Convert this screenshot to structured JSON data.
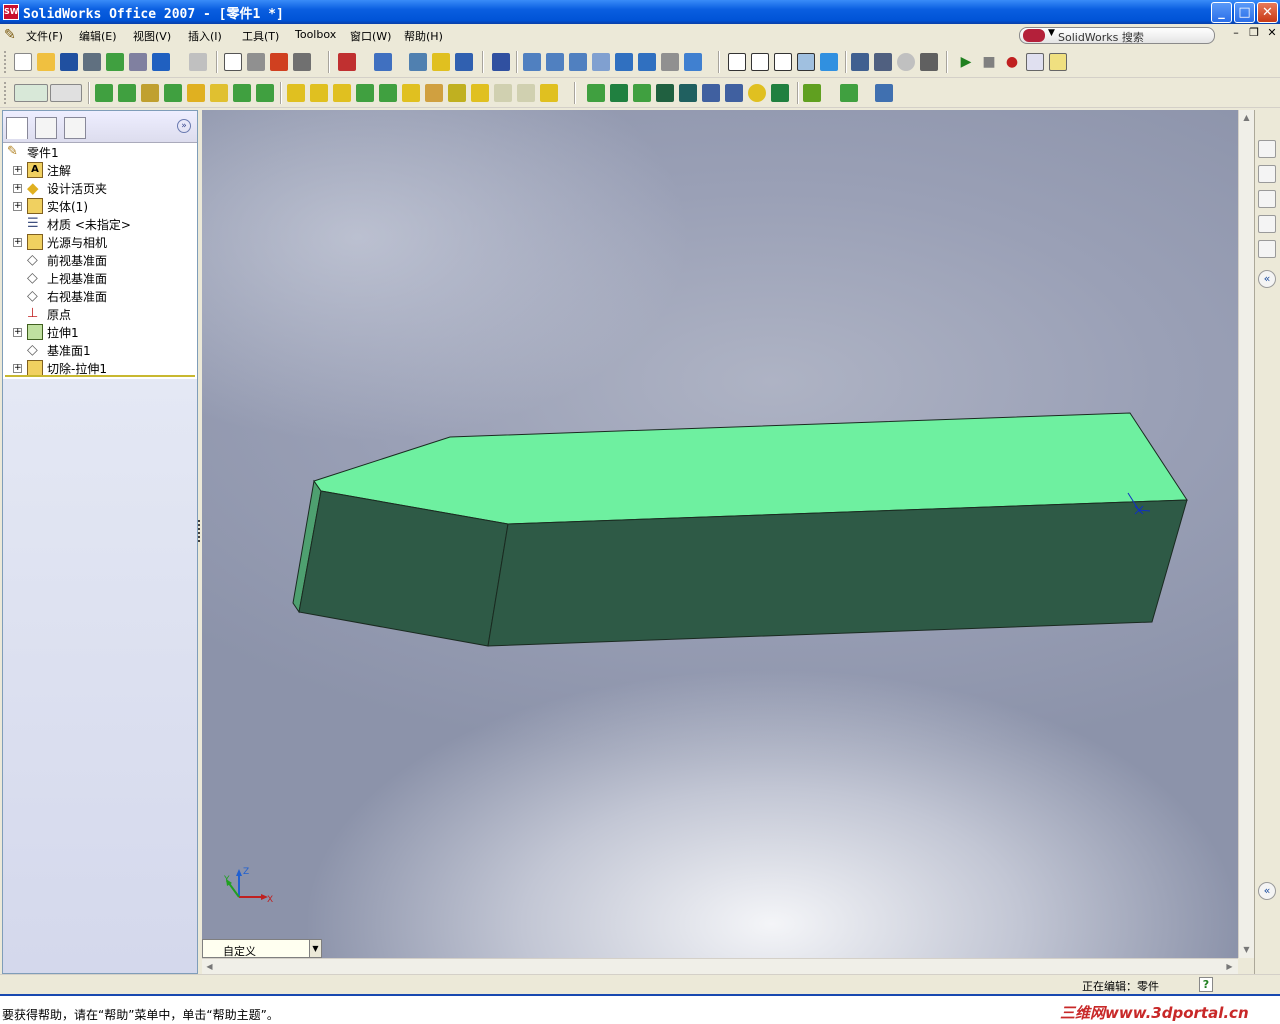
{
  "window": {
    "title": "SolidWorks Office 2007 - [零件1 *]",
    "app_icon": "SW"
  },
  "menu": [
    "文件(F)",
    "编辑(E)",
    "视图(V)",
    "插入(I)",
    "工具(T)",
    "Toolbox",
    "窗口(W)",
    "帮助(H)"
  ],
  "search": {
    "placeholder": "SolidWorks 搜索"
  },
  "feature_tree": {
    "root": "零件1",
    "items": [
      {
        "label": "注解",
        "icon": "annotation-icon",
        "expandable": true
      },
      {
        "label": "设计活页夹",
        "icon": "design-binder-icon",
        "expandable": true
      },
      {
        "label": "实体(1)",
        "icon": "solid-bodies-icon",
        "expandable": true
      },
      {
        "label": "材质 <未指定>",
        "icon": "material-icon",
        "expandable": false
      },
      {
        "label": "光源与相机",
        "icon": "lights-cameras-icon",
        "expandable": true
      },
      {
        "label": "前视基准面",
        "icon": "plane-icon",
        "expandable": false
      },
      {
        "label": "上视基准面",
        "icon": "plane-icon",
        "expandable": false
      },
      {
        "label": "右视基准面",
        "icon": "plane-icon",
        "expandable": false
      },
      {
        "label": "原点",
        "icon": "origin-icon",
        "expandable": false
      },
      {
        "label": "拉伸1",
        "icon": "extrude-icon",
        "expandable": true
      },
      {
        "label": "基准面1",
        "icon": "plane-icon",
        "expandable": false
      },
      {
        "label": "切除-拉伸1",
        "icon": "cut-extrude-icon",
        "expandable": true
      }
    ]
  },
  "triad": {
    "x": "X",
    "y": "Y",
    "z": "Z"
  },
  "configuration": {
    "current": "自定义"
  },
  "status": {
    "editing": "正在编辑：零件",
    "help_icon": "?",
    "message": "要获得帮助，请在“帮助”菜单中，单击“帮助主题”。",
    "watermark": "三维网www.3dportal.cn"
  },
  "colors": {
    "face_top": "#6ef0a0",
    "face_front": "#2e5a46",
    "face_side": "#4ea070",
    "titlebar": "#0053d6"
  }
}
